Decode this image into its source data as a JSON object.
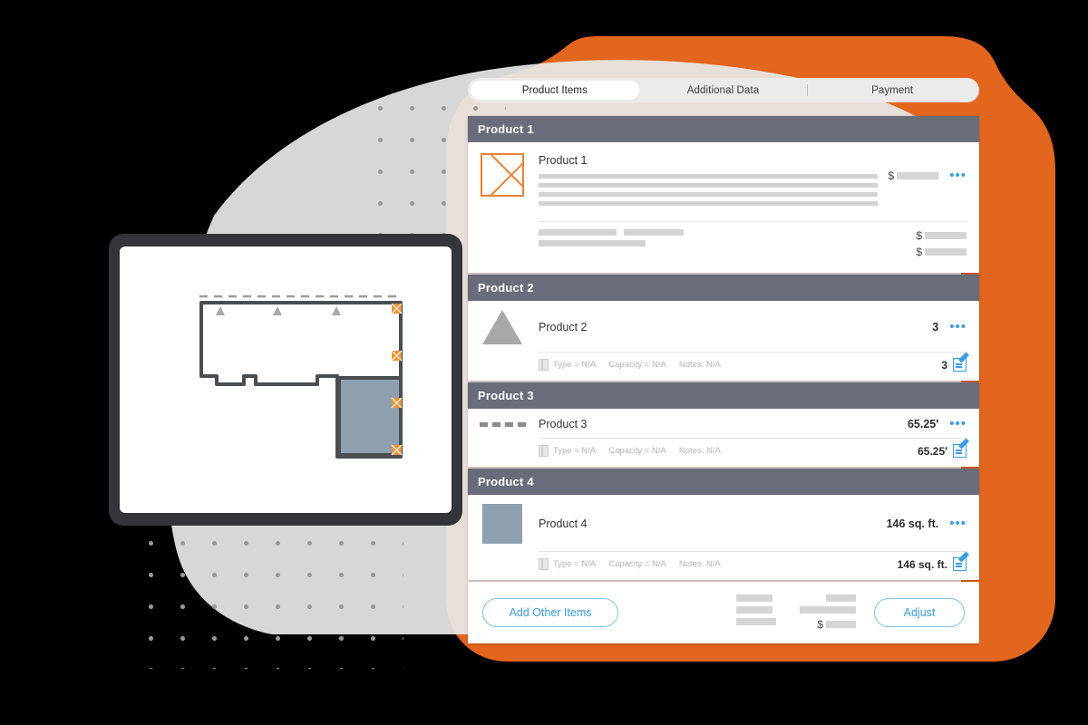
{
  "theme": {
    "orange": "#E2661E",
    "accent_blue": "#3C9CE4",
    "header_slate": "#696D79",
    "thumb_orange": "#E8823A",
    "blue_gray_fill": "#8FA0AE",
    "tabbar_bg": "#ECEAEA"
  },
  "tabs": [
    {
      "label": "Product Items",
      "active": true
    },
    {
      "label": "Additional Data",
      "active": false
    },
    {
      "label": "Payment",
      "active": false
    }
  ],
  "panels": [
    {
      "header": "Product 1",
      "item_name": "Product 1",
      "icon": "image-placeholder-x-icon",
      "currency": "$",
      "value": "",
      "menu": "•••",
      "subtotal_currency": "$",
      "total_currency": "$"
    },
    {
      "header": "Product 2",
      "item_name": "Product 2",
      "icon": "triangle-shape-icon",
      "value": "3",
      "menu": "•••",
      "meta": {
        "type": "Type = N/A",
        "capacity": "Capacity = N/A",
        "notes": "Notes: N/A"
      },
      "meta_value": "3"
    },
    {
      "header": "Product 3",
      "item_name": "Product 3",
      "icon": "dashed-line-icon",
      "value": "65.25′",
      "menu": "•••",
      "meta": {
        "type": "Type = N/A",
        "capacity": "Capacity = N/A",
        "notes": "Notes: N/A"
      },
      "meta_value": "65.25′"
    },
    {
      "header": "Product 4",
      "item_name": "Product 4",
      "icon": "filled-square-icon",
      "value": "146 sq. ft.",
      "menu": "•••",
      "meta": {
        "type": "Type = N/A",
        "capacity": "Capacity = N/A",
        "notes": "Notes: N/A"
      },
      "meta_value": "146 sq. ft."
    }
  ],
  "footer": {
    "add_items_label": "Add Other Items",
    "adjust_label": "Adjust",
    "total_currency": "$"
  },
  "floorplan": {
    "title": "floor-plan-canvas",
    "vertex_markers": 4,
    "roof_markers": 3,
    "selected_room_fill": "#8FA0AE"
  }
}
